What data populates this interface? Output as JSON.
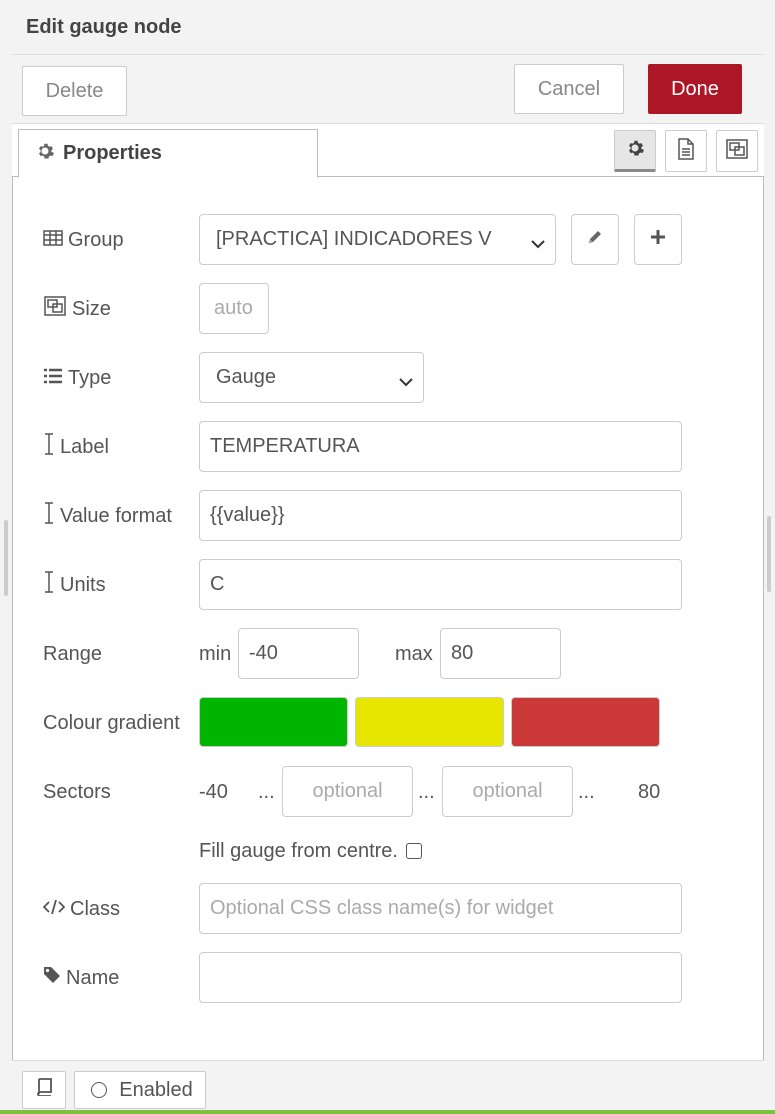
{
  "header": {
    "title": "Edit gauge node"
  },
  "toolbar": {
    "delete_label": "Delete",
    "cancel_label": "Cancel",
    "done_label": "Done"
  },
  "tabs": {
    "properties_label": "Properties"
  },
  "form": {
    "group": {
      "label": "Group",
      "value": "[PRACTICA] INDICADORES V"
    },
    "size": {
      "label": "Size",
      "value": "auto"
    },
    "type": {
      "label": "Type",
      "value": "Gauge"
    },
    "label_field": {
      "label": "Label",
      "value": "TEMPERATURA"
    },
    "value_format": {
      "label": "Value format",
      "value": "{{value}}"
    },
    "units": {
      "label": "Units",
      "value": "C"
    },
    "range": {
      "label": "Range",
      "min_label": "min",
      "min_value": "-40",
      "max_label": "max",
      "max_value": "80"
    },
    "colour_gradient": {
      "label": "Colour gradient",
      "colors": [
        "#00b500",
        "#e6e600",
        "#ca3838"
      ]
    },
    "sectors": {
      "label": "Sectors",
      "start": "-40",
      "sep": "...",
      "placeholder1": "optional",
      "placeholder2": "optional",
      "end": "80"
    },
    "fill_centre": {
      "label": "Fill gauge from centre."
    },
    "class_field": {
      "label": "Class",
      "placeholder": "Optional CSS class name(s) for widget"
    },
    "name_field": {
      "label": "Name",
      "value": ""
    }
  },
  "footer": {
    "enabled_label": "Enabled"
  },
  "colors": {
    "accent": "#ad1625",
    "status_bar": "#7ac143"
  }
}
